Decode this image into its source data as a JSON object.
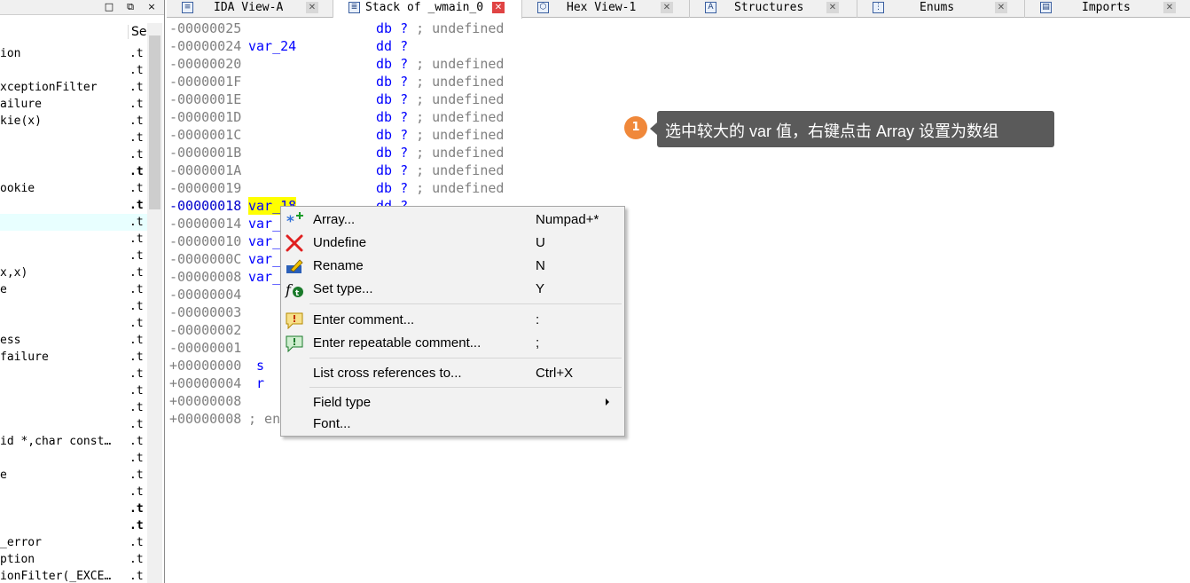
{
  "left_panel": {
    "column_header": "Se",
    "window_buttons": [
      "□",
      "⧉",
      "×"
    ],
    "rows": [
      {
        "name": "ion",
        "seg": ".t"
      },
      {
        "name": "",
        "seg": ".t"
      },
      {
        "name": "xceptionFilter",
        "seg": ".t"
      },
      {
        "name": "ailure",
        "seg": ".t"
      },
      {
        "name": "kie(x)",
        "seg": ".t"
      },
      {
        "name": "",
        "seg": ".t"
      },
      {
        "name": "",
        "seg": ".t"
      },
      {
        "name": "",
        "seg": ".t"
      },
      {
        "name": "ookie",
        "seg": ".t"
      },
      {
        "name": "",
        "seg": ".t"
      },
      {
        "name": "",
        "seg": ".t"
      },
      {
        "name": "",
        "seg": ".t"
      },
      {
        "name": "",
        "seg": ".t"
      },
      {
        "name": "x,x)",
        "seg": ".t"
      },
      {
        "name": "e",
        "seg": ".t"
      },
      {
        "name": "",
        "seg": ".t"
      },
      {
        "name": "",
        "seg": ".t"
      },
      {
        "name": "ess",
        "seg": ".t"
      },
      {
        "name": "failure",
        "seg": ".t"
      },
      {
        "name": "",
        "seg": ".t"
      },
      {
        "name": "",
        "seg": ".t"
      },
      {
        "name": "",
        "seg": ".t"
      },
      {
        "name": "",
        "seg": ".t"
      },
      {
        "name": "id *,char const…",
        "seg": ".t"
      },
      {
        "name": "",
        "seg": ".t"
      },
      {
        "name": "e",
        "seg": ".t"
      },
      {
        "name": "",
        "seg": ".t"
      },
      {
        "name": "",
        "seg": ".t"
      },
      {
        "name": "",
        "seg": ".t"
      },
      {
        "name": "_error",
        "seg": ".t"
      },
      {
        "name": "ption",
        "seg": ".t"
      },
      {
        "name": "ionFilter(_EXCE…",
        "seg": ".t"
      }
    ]
  },
  "tabs": [
    {
      "label": "IDA View-A",
      "icon": "document-icon"
    },
    {
      "label": "Stack of _wmain_0",
      "icon": "stack-icon"
    },
    {
      "label": "Hex View-1",
      "icon": "hex-icon"
    },
    {
      "label": "Structures",
      "icon": "structures-icon"
    },
    {
      "label": "Enums",
      "icon": "enums-icon"
    },
    {
      "label": "Imports",
      "icon": "imports-icon"
    }
  ],
  "stack_rows": [
    {
      "offset": "-00000025",
      "name": "",
      "type": "db",
      "value": "?",
      "comment": "; undefined"
    },
    {
      "offset": "-00000024",
      "name": "var_24",
      "type": "dd",
      "value": "?",
      "comment": ""
    },
    {
      "offset": "-00000020",
      "name": "",
      "type": "db",
      "value": "?",
      "comment": "; undefined"
    },
    {
      "offset": "-0000001F",
      "name": "",
      "type": "db",
      "value": "?",
      "comment": "; undefined"
    },
    {
      "offset": "-0000001E",
      "name": "",
      "type": "db",
      "value": "?",
      "comment": "; undefined"
    },
    {
      "offset": "-0000001D",
      "name": "",
      "type": "db",
      "value": "?",
      "comment": "; undefined"
    },
    {
      "offset": "-0000001C",
      "name": "",
      "type": "db",
      "value": "?",
      "comment": "; undefined"
    },
    {
      "offset": "-0000001B",
      "name": "",
      "type": "db",
      "value": "?",
      "comment": "; undefined"
    },
    {
      "offset": "-0000001A",
      "name": "",
      "type": "db",
      "value": "?",
      "comment": "; undefined"
    },
    {
      "offset": "-00000019",
      "name": "",
      "type": "db",
      "value": "?",
      "comment": "; undefined"
    },
    {
      "offset": "-00000018",
      "name": "var_18",
      "type": "dd",
      "value": "?",
      "comment": ""
    },
    {
      "offset": "-00000014",
      "name": "var_",
      "type": "",
      "value": "",
      "comment": ""
    },
    {
      "offset": "-00000010",
      "name": "var_",
      "type": "",
      "value": "",
      "comment": ""
    },
    {
      "offset": "-0000000C",
      "name": "var_",
      "type": "",
      "value": "",
      "comment": ""
    },
    {
      "offset": "-00000008",
      "name": "var_",
      "type": "",
      "value": "",
      "comment": ""
    },
    {
      "offset": "-00000004",
      "name": "",
      "type": "",
      "value": "",
      "comment": ""
    },
    {
      "offset": "-00000003",
      "name": "",
      "type": "",
      "value": "",
      "comment": ""
    },
    {
      "offset": "-00000002",
      "name": "",
      "type": "",
      "value": "",
      "comment": ""
    },
    {
      "offset": "-00000001",
      "name": "",
      "type": "",
      "value": "",
      "comment": ""
    },
    {
      "offset": "+00000000",
      "name": "s",
      "type": "",
      "value": "",
      "comment": ""
    },
    {
      "offset": "+00000004",
      "name": "r",
      "type": "",
      "value": "",
      "comment": ""
    },
    {
      "offset": "+00000008",
      "name": "",
      "type": "",
      "value": "",
      "comment": ""
    },
    {
      "offset": "+00000008",
      "name": "",
      "type": "",
      "value": "",
      "comment": "; en"
    }
  ],
  "context_menu": {
    "items": [
      {
        "label": "Array...",
        "shortcut": "Numpad+*",
        "icon": "array-icon"
      },
      {
        "label": "Undefine",
        "shortcut": "U",
        "icon": "undefine-icon"
      },
      {
        "label": "Rename",
        "shortcut": "N",
        "icon": "rename-icon"
      },
      {
        "label": "Set type...",
        "shortcut": "Y",
        "icon": "set-type-icon"
      },
      {
        "label": "Enter comment...",
        "shortcut": ":",
        "icon": "comment-icon"
      },
      {
        "label": "Enter repeatable comment...",
        "shortcut": ";",
        "icon": "repeatable-comment-icon"
      },
      {
        "label": "List cross references to...",
        "shortcut": "Ctrl+X",
        "icon": ""
      },
      {
        "label": "Field type",
        "shortcut": "",
        "icon": ""
      },
      {
        "label": "Font...",
        "shortcut": "",
        "icon": ""
      }
    ]
  },
  "annotation": {
    "step": "1",
    "text": "选中较大的 var 值，右键点击 Array 设置为数组",
    "badge_color": "#f0883a"
  }
}
